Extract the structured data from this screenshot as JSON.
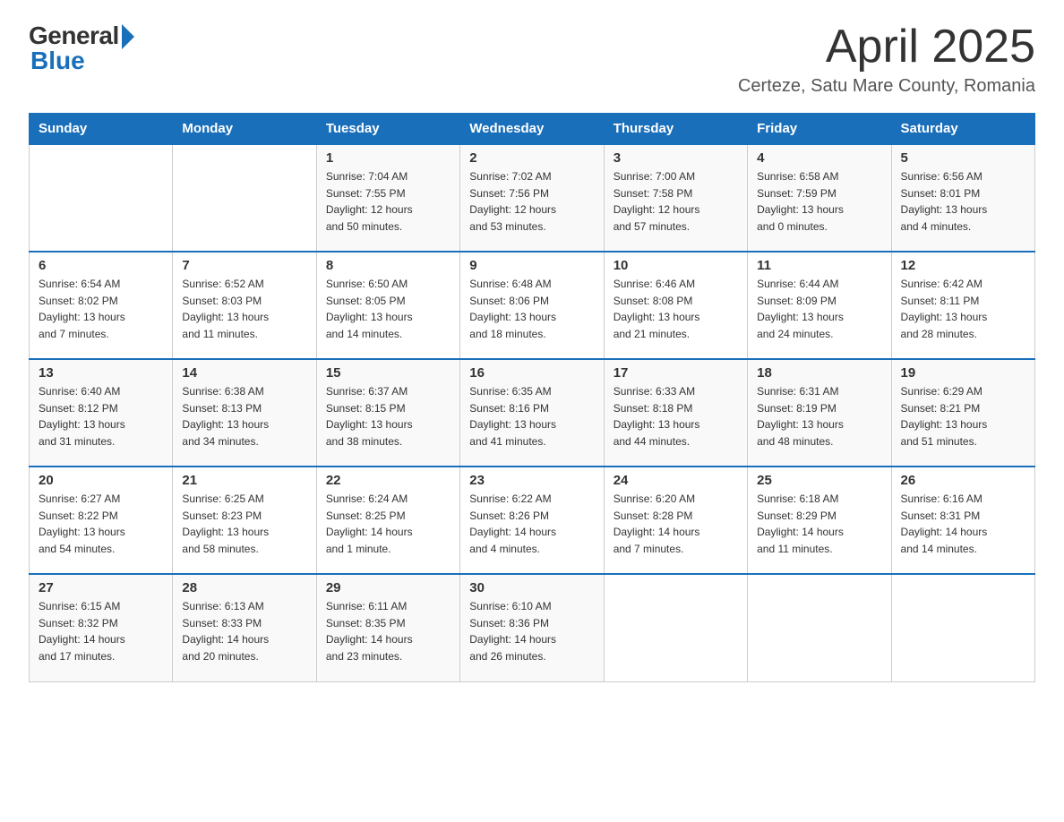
{
  "header": {
    "logo_general": "General",
    "logo_blue": "Blue",
    "title": "April 2025",
    "location": "Certeze, Satu Mare County, Romania"
  },
  "weekdays": [
    "Sunday",
    "Monday",
    "Tuesday",
    "Wednesday",
    "Thursday",
    "Friday",
    "Saturday"
  ],
  "weeks": [
    [
      {
        "day": "",
        "info": ""
      },
      {
        "day": "",
        "info": ""
      },
      {
        "day": "1",
        "info": "Sunrise: 7:04 AM\nSunset: 7:55 PM\nDaylight: 12 hours\nand 50 minutes."
      },
      {
        "day": "2",
        "info": "Sunrise: 7:02 AM\nSunset: 7:56 PM\nDaylight: 12 hours\nand 53 minutes."
      },
      {
        "day": "3",
        "info": "Sunrise: 7:00 AM\nSunset: 7:58 PM\nDaylight: 12 hours\nand 57 minutes."
      },
      {
        "day": "4",
        "info": "Sunrise: 6:58 AM\nSunset: 7:59 PM\nDaylight: 13 hours\nand 0 minutes."
      },
      {
        "day": "5",
        "info": "Sunrise: 6:56 AM\nSunset: 8:01 PM\nDaylight: 13 hours\nand 4 minutes."
      }
    ],
    [
      {
        "day": "6",
        "info": "Sunrise: 6:54 AM\nSunset: 8:02 PM\nDaylight: 13 hours\nand 7 minutes."
      },
      {
        "day": "7",
        "info": "Sunrise: 6:52 AM\nSunset: 8:03 PM\nDaylight: 13 hours\nand 11 minutes."
      },
      {
        "day": "8",
        "info": "Sunrise: 6:50 AM\nSunset: 8:05 PM\nDaylight: 13 hours\nand 14 minutes."
      },
      {
        "day": "9",
        "info": "Sunrise: 6:48 AM\nSunset: 8:06 PM\nDaylight: 13 hours\nand 18 minutes."
      },
      {
        "day": "10",
        "info": "Sunrise: 6:46 AM\nSunset: 8:08 PM\nDaylight: 13 hours\nand 21 minutes."
      },
      {
        "day": "11",
        "info": "Sunrise: 6:44 AM\nSunset: 8:09 PM\nDaylight: 13 hours\nand 24 minutes."
      },
      {
        "day": "12",
        "info": "Sunrise: 6:42 AM\nSunset: 8:11 PM\nDaylight: 13 hours\nand 28 minutes."
      }
    ],
    [
      {
        "day": "13",
        "info": "Sunrise: 6:40 AM\nSunset: 8:12 PM\nDaylight: 13 hours\nand 31 minutes."
      },
      {
        "day": "14",
        "info": "Sunrise: 6:38 AM\nSunset: 8:13 PM\nDaylight: 13 hours\nand 34 minutes."
      },
      {
        "day": "15",
        "info": "Sunrise: 6:37 AM\nSunset: 8:15 PM\nDaylight: 13 hours\nand 38 minutes."
      },
      {
        "day": "16",
        "info": "Sunrise: 6:35 AM\nSunset: 8:16 PM\nDaylight: 13 hours\nand 41 minutes."
      },
      {
        "day": "17",
        "info": "Sunrise: 6:33 AM\nSunset: 8:18 PM\nDaylight: 13 hours\nand 44 minutes."
      },
      {
        "day": "18",
        "info": "Sunrise: 6:31 AM\nSunset: 8:19 PM\nDaylight: 13 hours\nand 48 minutes."
      },
      {
        "day": "19",
        "info": "Sunrise: 6:29 AM\nSunset: 8:21 PM\nDaylight: 13 hours\nand 51 minutes."
      }
    ],
    [
      {
        "day": "20",
        "info": "Sunrise: 6:27 AM\nSunset: 8:22 PM\nDaylight: 13 hours\nand 54 minutes."
      },
      {
        "day": "21",
        "info": "Sunrise: 6:25 AM\nSunset: 8:23 PM\nDaylight: 13 hours\nand 58 minutes."
      },
      {
        "day": "22",
        "info": "Sunrise: 6:24 AM\nSunset: 8:25 PM\nDaylight: 14 hours\nand 1 minute."
      },
      {
        "day": "23",
        "info": "Sunrise: 6:22 AM\nSunset: 8:26 PM\nDaylight: 14 hours\nand 4 minutes."
      },
      {
        "day": "24",
        "info": "Sunrise: 6:20 AM\nSunset: 8:28 PM\nDaylight: 14 hours\nand 7 minutes."
      },
      {
        "day": "25",
        "info": "Sunrise: 6:18 AM\nSunset: 8:29 PM\nDaylight: 14 hours\nand 11 minutes."
      },
      {
        "day": "26",
        "info": "Sunrise: 6:16 AM\nSunset: 8:31 PM\nDaylight: 14 hours\nand 14 minutes."
      }
    ],
    [
      {
        "day": "27",
        "info": "Sunrise: 6:15 AM\nSunset: 8:32 PM\nDaylight: 14 hours\nand 17 minutes."
      },
      {
        "day": "28",
        "info": "Sunrise: 6:13 AM\nSunset: 8:33 PM\nDaylight: 14 hours\nand 20 minutes."
      },
      {
        "day": "29",
        "info": "Sunrise: 6:11 AM\nSunset: 8:35 PM\nDaylight: 14 hours\nand 23 minutes."
      },
      {
        "day": "30",
        "info": "Sunrise: 6:10 AM\nSunset: 8:36 PM\nDaylight: 14 hours\nand 26 minutes."
      },
      {
        "day": "",
        "info": ""
      },
      {
        "day": "",
        "info": ""
      },
      {
        "day": "",
        "info": ""
      }
    ]
  ]
}
